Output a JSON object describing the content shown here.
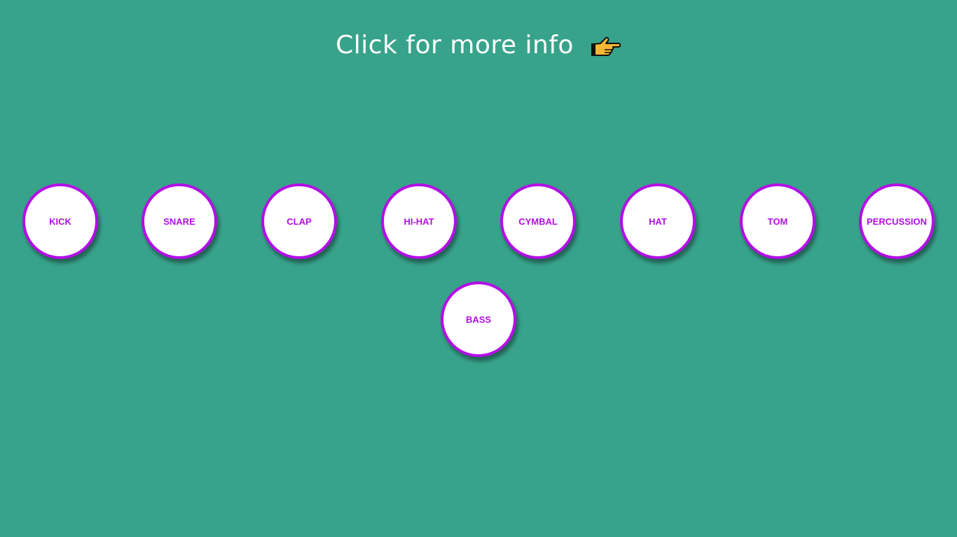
{
  "header": {
    "text": "Click for more info",
    "icon": "pointing-hand-icon"
  },
  "pads": [
    {
      "label": "KICK"
    },
    {
      "label": "SNARE"
    },
    {
      "label": "CLAP"
    },
    {
      "label": "HI-HAT"
    },
    {
      "label": "CYMBAL"
    },
    {
      "label": "HAT"
    },
    {
      "label": "TOM"
    },
    {
      "label": "PERCUSSION"
    },
    {
      "label": "BASS"
    }
  ],
  "colors": {
    "background": "#38a38b",
    "pad_border": "#b30ee6",
    "pad_label": "#b30ee6",
    "pad_fill": "#ffffff",
    "header_text": "#ffffff"
  }
}
